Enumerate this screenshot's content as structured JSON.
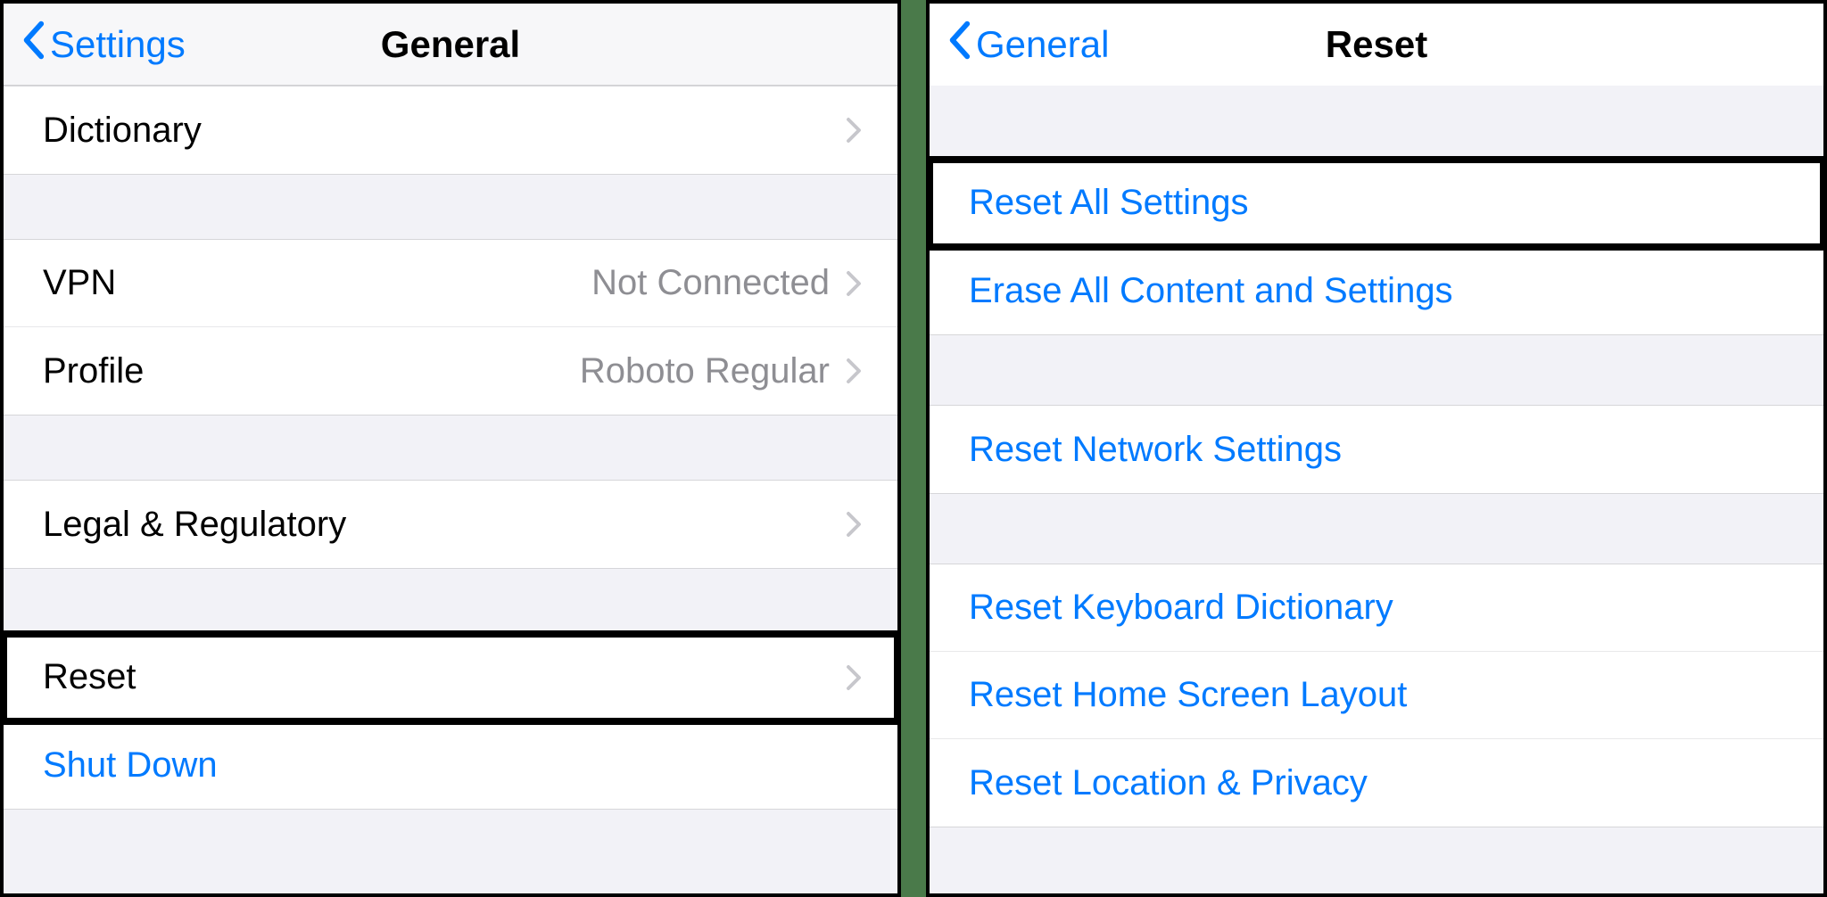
{
  "left": {
    "nav": {
      "back": "Settings",
      "title": "General"
    },
    "rows": {
      "dictionary": "Dictionary",
      "vpn": {
        "label": "VPN",
        "detail": "Not Connected"
      },
      "profile": {
        "label": "Profile",
        "detail": "Roboto Regular"
      },
      "legal": "Legal & Regulatory",
      "reset": "Reset",
      "shutdown": "Shut Down"
    }
  },
  "right": {
    "nav": {
      "back": "General",
      "title": "Reset"
    },
    "rows": {
      "reset_all": "Reset All Settings",
      "erase_all": "Erase All Content and Settings",
      "reset_network": "Reset Network Settings",
      "reset_keyboard": "Reset Keyboard Dictionary",
      "reset_home": "Reset Home Screen Layout",
      "reset_location": "Reset Location & Privacy"
    }
  }
}
